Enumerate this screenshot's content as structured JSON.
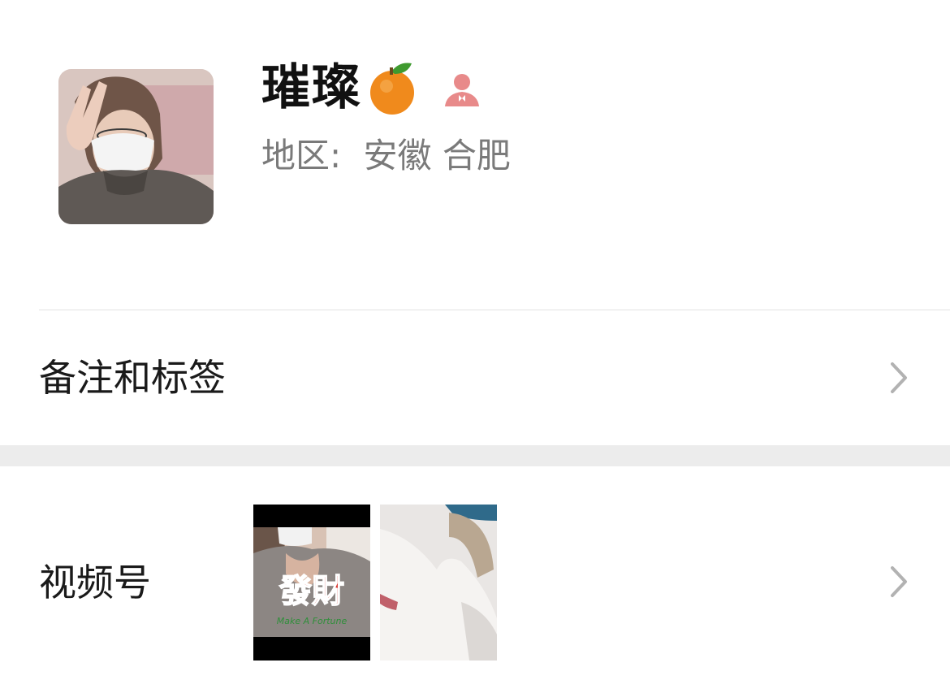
{
  "profile": {
    "name": "璀璨",
    "region_label": "地区:",
    "region_value": "安徽 合肥",
    "name_emoji": "orange-icon",
    "gender_icon": "female-user-icon",
    "gender_color": "#e88a8a"
  },
  "rows": {
    "remark_label": "备注和标签",
    "channels_label": "视频号"
  },
  "channels": {
    "thumb1_caption_cn": "發財",
    "thumb1_caption_en": "Make A Fortune"
  },
  "colors": {
    "separator": "#ececec",
    "chevron": "#b2b2b2",
    "caption_red": "#d8332c"
  }
}
